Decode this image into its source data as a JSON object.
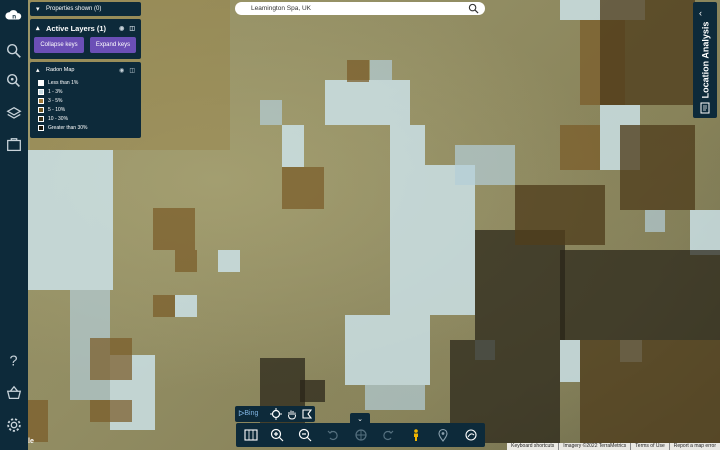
{
  "search": {
    "value": "Leamington Spa, UK"
  },
  "properties_panel": {
    "label": "Properties shown (0)"
  },
  "layers_panel": {
    "title": "Active Layers (1)",
    "collapse_label": "Collapse keys",
    "expand_label": "Expand keys"
  },
  "legend": {
    "title": "Radon Map",
    "items": [
      {
        "label": "Less than 1%",
        "color": "#ffffff"
      },
      {
        "label": "1 - 3%",
        "color": "#c9dde4"
      },
      {
        "label": "3 - 5%",
        "color": "#a07a3a"
      },
      {
        "label": "5 - 10%",
        "color": "#6e5522"
      },
      {
        "label": "10 - 30%",
        "color": "#3c3218"
      },
      {
        "label": "Greater than 30%",
        "color": "#1f1a0e"
      }
    ]
  },
  "right_tab": {
    "label": "Location Analysis"
  },
  "bing_label": "Bing",
  "attribution": {
    "shortcuts": "Keyboard shortcuts",
    "imagery": "Imagery ©2022 TerraMetrics",
    "terms": "Terms of Use",
    "report": "Report a map error"
  },
  "google_mark": "le"
}
